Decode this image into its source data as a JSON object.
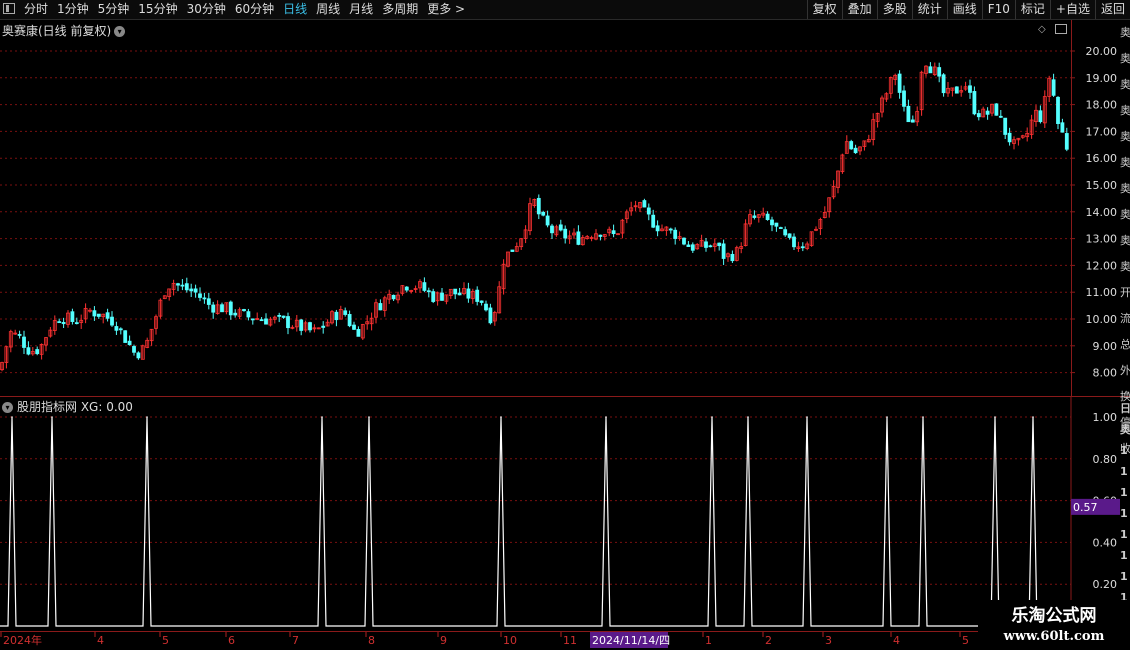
{
  "toolbar": {
    "periods": [
      "分时",
      "1分钟",
      "5分钟",
      "15分钟",
      "30分钟",
      "60分钟",
      "日线",
      "周线",
      "月线",
      "多周期",
      "更多 >"
    ],
    "active_period": "日线",
    "right_buttons": [
      "复权",
      "叠加",
      "多股",
      "统计",
      "画线",
      "F10",
      "标记",
      "+自选",
      "返回"
    ]
  },
  "stock": {
    "title": "奥赛康(日线 前复权)"
  },
  "indicator": {
    "title": "股朋指标网 XG: 0.00",
    "current_value_tag": "0.57"
  },
  "watermark": {
    "line1": "乐淘公式网",
    "line2": "www.60lt.com"
  },
  "date_axis": {
    "labels": [
      "2024年",
      "4",
      "5",
      "6",
      "7",
      "8",
      "9",
      "10",
      "11",
      "2024/11/14/四",
      "1",
      "2",
      "3",
      "4",
      "5"
    ]
  },
  "colors": {
    "up": "#ff3232",
    "down": "#54ffff",
    "grid": "#7a1010",
    "active_tab": "#3bc0e8",
    "highlight": "#5a1a8a"
  },
  "chart_data": [
    {
      "type": "candlestick",
      "title": "奥赛康(日线 前复权)",
      "ylim": [
        7.5,
        20.6
      ],
      "y_ticks": [
        "20.00",
        "19.00",
        "18.00",
        "17.00",
        "16.00",
        "15.00",
        "14.00",
        "13.00",
        "12.00",
        "11.00",
        "10.00",
        "9.00",
        "8.00"
      ],
      "close_path": [
        [
          0,
          8.1
        ],
        [
          10,
          9.5
        ],
        [
          20,
          9.3
        ],
        [
          30,
          8.8
        ],
        [
          40,
          8.9
        ],
        [
          50,
          9.7
        ],
        [
          60,
          10.1
        ],
        [
          75,
          9.9
        ],
        [
          90,
          10.3
        ],
        [
          100,
          10.2
        ],
        [
          115,
          9.9
        ],
        [
          125,
          9.3
        ],
        [
          135,
          8.7
        ],
        [
          145,
          8.9
        ],
        [
          155,
          10.0
        ],
        [
          165,
          11.1
        ],
        [
          172,
          11.4
        ],
        [
          180,
          11.2
        ],
        [
          195,
          11.0
        ],
        [
          210,
          10.5
        ],
        [
          225,
          10.4
        ],
        [
          245,
          10.1
        ],
        [
          265,
          10.0
        ],
        [
          285,
          9.9
        ],
        [
          300,
          9.7
        ],
        [
          315,
          9.5
        ],
        [
          325,
          9.8
        ],
        [
          335,
          10.2
        ],
        [
          345,
          10.2
        ],
        [
          355,
          9.5
        ],
        [
          365,
          9.8
        ],
        [
          375,
          10.4
        ],
        [
          390,
          10.9
        ],
        [
          405,
          11.3
        ],
        [
          420,
          11.2
        ],
        [
          435,
          10.8
        ],
        [
          450,
          11.0
        ],
        [
          465,
          10.9
        ],
        [
          480,
          10.8
        ],
        [
          492,
          10.0
        ],
        [
          498,
          10.8
        ],
        [
          503,
          12.2
        ],
        [
          512,
          12.6
        ],
        [
          520,
          13.0
        ],
        [
          528,
          13.8
        ],
        [
          533,
          14.5
        ],
        [
          540,
          13.8
        ],
        [
          550,
          13.3
        ],
        [
          565,
          13.1
        ],
        [
          580,
          13.0
        ],
        [
          590,
          13.2
        ],
        [
          600,
          13.3
        ],
        [
          615,
          13.1
        ],
        [
          625,
          13.8
        ],
        [
          635,
          14.3
        ],
        [
          648,
          13.8
        ],
        [
          660,
          13.4
        ],
        [
          675,
          13.2
        ],
        [
          690,
          12.7
        ],
        [
          705,
          12.7
        ],
        [
          715,
          12.8
        ],
        [
          725,
          12.3
        ],
        [
          738,
          12.5
        ],
        [
          748,
          13.7
        ],
        [
          760,
          13.8
        ],
        [
          770,
          13.6
        ],
        [
          780,
          13.2
        ],
        [
          790,
          12.8
        ],
        [
          805,
          12.8
        ],
        [
          815,
          13.4
        ],
        [
          825,
          14.0
        ],
        [
          835,
          15.0
        ],
        [
          845,
          16.7
        ],
        [
          855,
          16.2
        ],
        [
          865,
          16.5
        ],
        [
          875,
          17.5
        ],
        [
          885,
          18.3
        ],
        [
          895,
          19.2
        ],
        [
          905,
          17.6
        ],
        [
          915,
          17.3
        ],
        [
          923,
          19.8
        ],
        [
          935,
          19.2
        ],
        [
          945,
          18.3
        ],
        [
          955,
          18.5
        ],
        [
          965,
          18.8
        ],
        [
          975,
          17.8
        ],
        [
          985,
          17.6
        ],
        [
          995,
          17.9
        ],
        [
          1005,
          17.0
        ],
        [
          1015,
          16.4
        ],
        [
          1025,
          16.7
        ],
        [
          1035,
          17.7
        ],
        [
          1042,
          17.5
        ],
        [
          1050,
          19.2
        ],
        [
          1058,
          17.3
        ],
        [
          1065,
          16.7
        ],
        [
          1070,
          16.0
        ]
      ]
    },
    {
      "type": "line",
      "title": "股朋指标网 XG: 0.00",
      "ylim": [
        0.0,
        1.05
      ],
      "y_ticks": [
        "1.00",
        "0.80",
        "0.60",
        "0.40",
        "0.20"
      ],
      "spike_x": [
        12,
        52,
        147,
        322,
        369,
        501,
        606,
        712,
        748,
        807,
        887,
        923,
        995,
        1033
      ],
      "baseline": 0.0,
      "spike_value": 1.0
    }
  ],
  "right_strip_chars": [
    "奥",
    "奥",
    "奥",
    "奥",
    "奥",
    "奥",
    "奥",
    "奥",
    "奥",
    "奥",
    "开",
    "流",
    "总",
    "外",
    "换",
    "停",
    "收"
  ],
  "right_strip_chars2": [
    "日",
    "奥",
    "1",
    "1",
    "1",
    "1",
    "1",
    "1",
    "1",
    "1",
    "1",
    "1"
  ]
}
